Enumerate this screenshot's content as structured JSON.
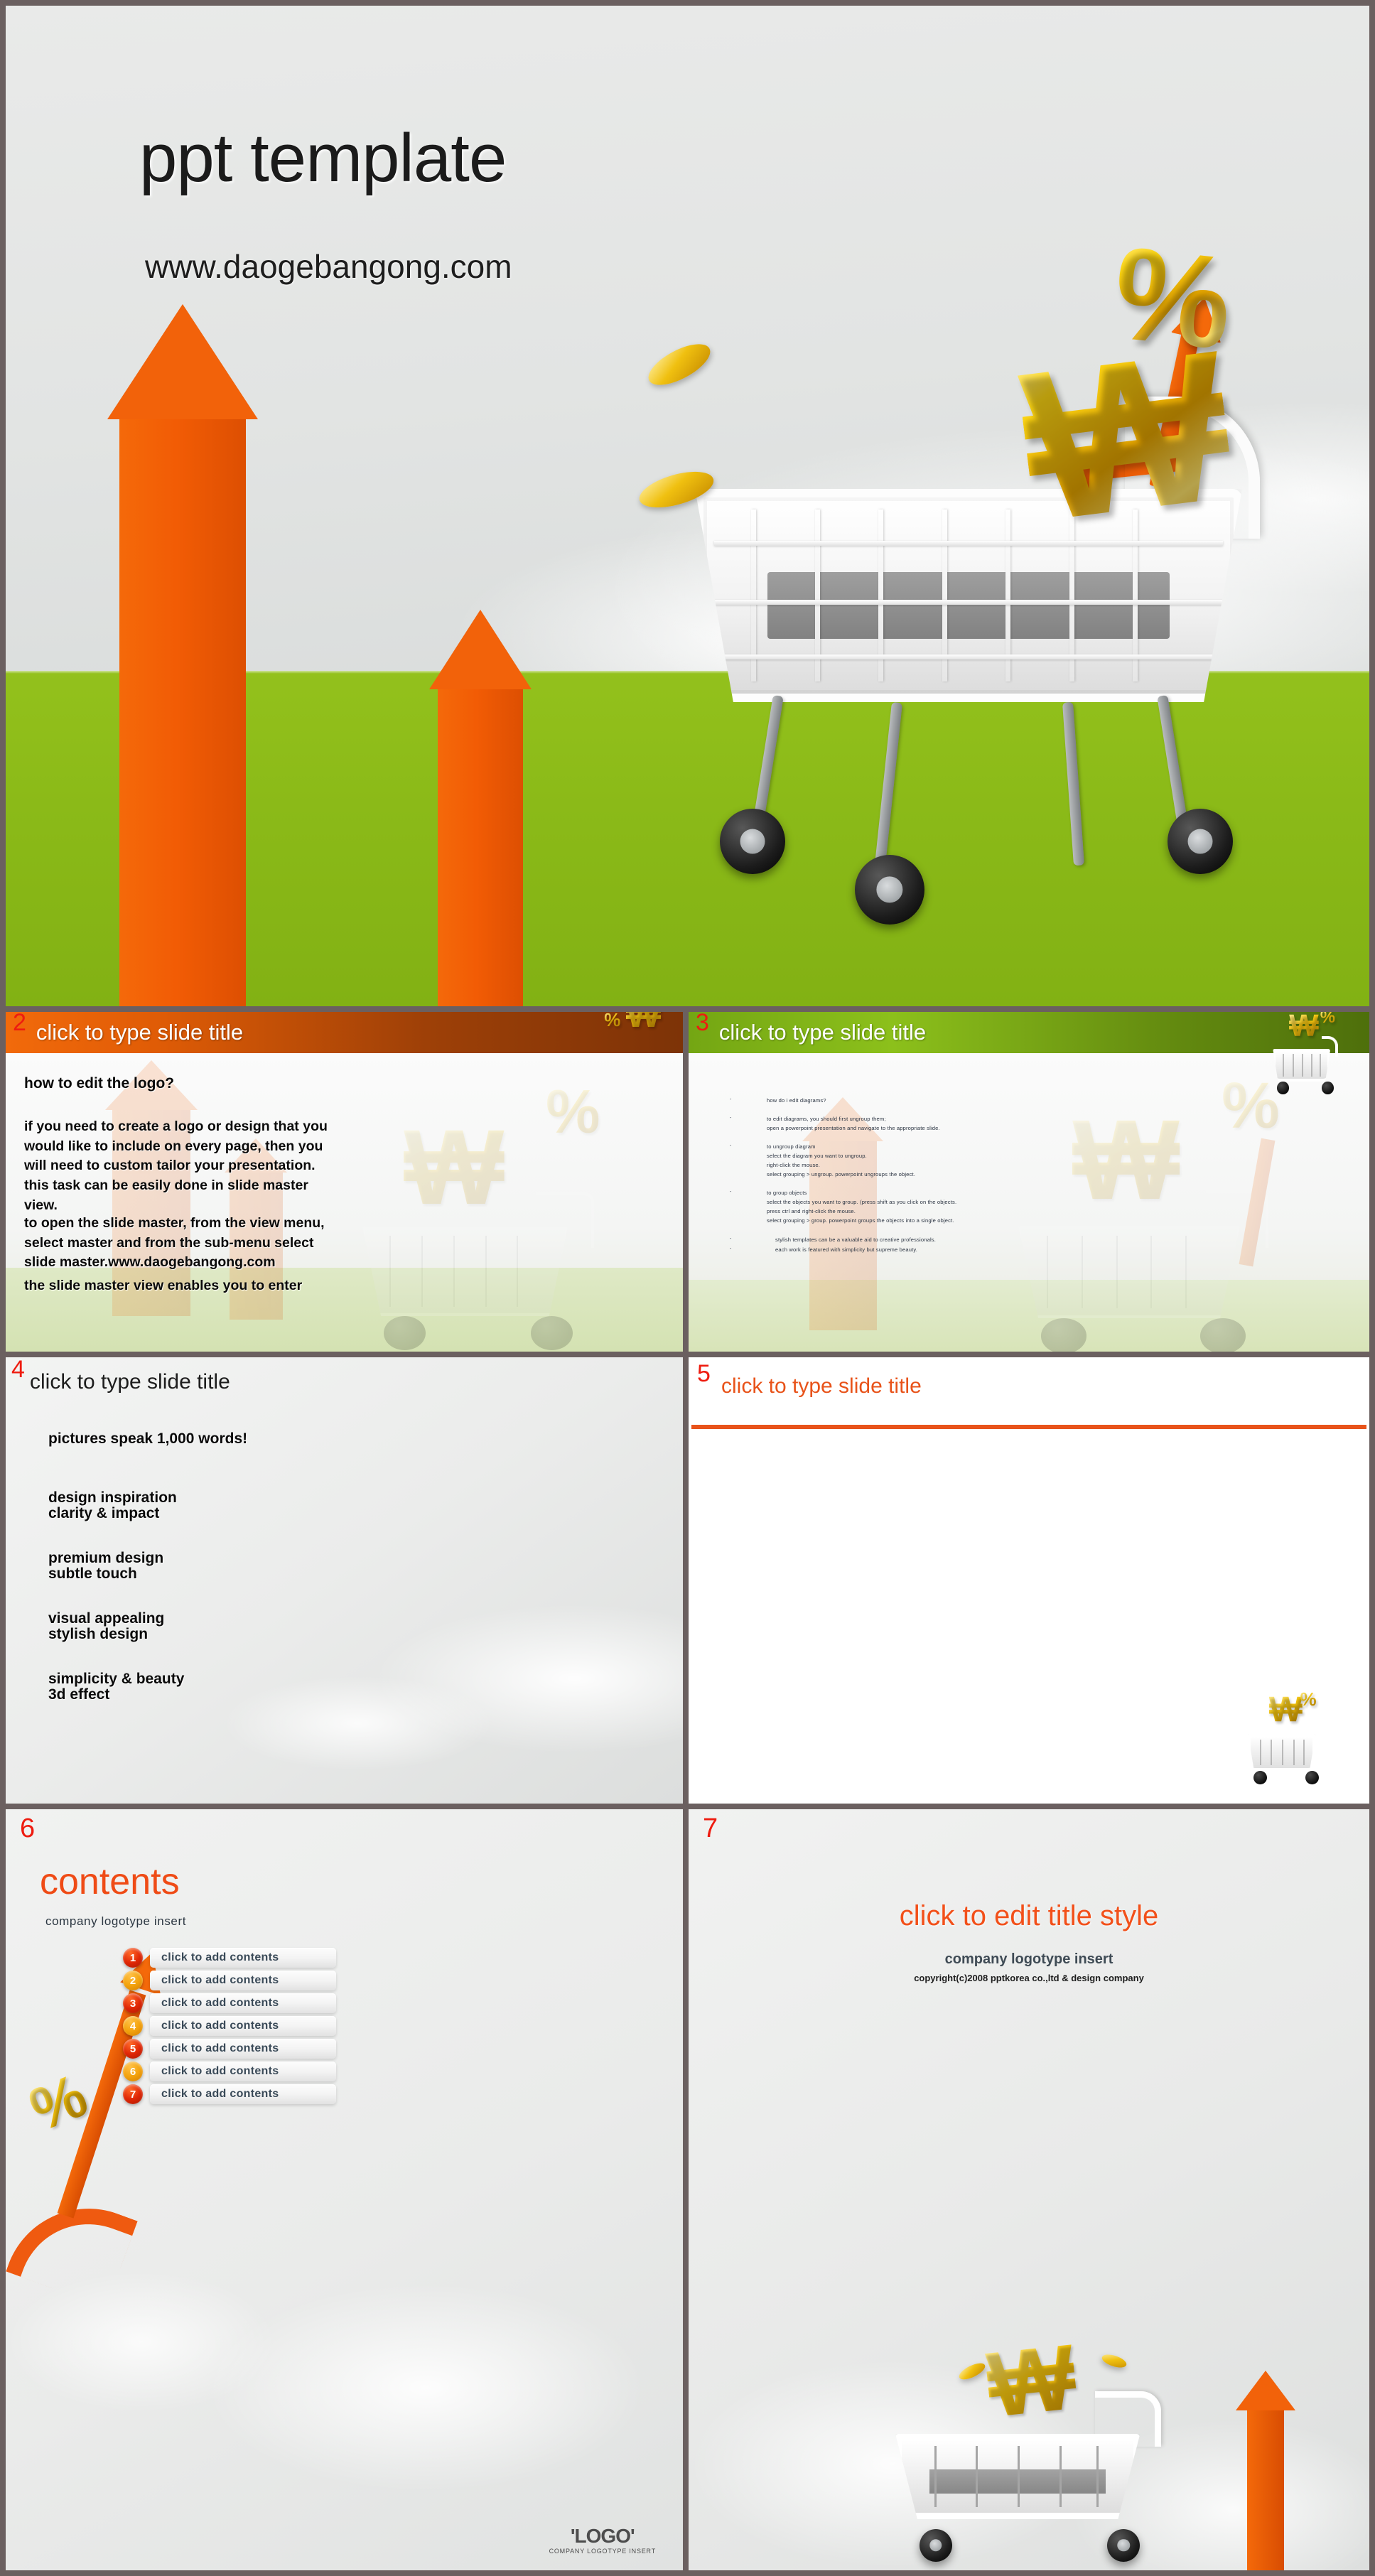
{
  "colors": {
    "orange": "#f2620a",
    "orange_text": "#e8531a",
    "red_number": "#ee1c10",
    "green_grass": "#8cbb19",
    "green_header": "#8cc01b",
    "gold": "#f0c010",
    "slate_text": "#3a4a58",
    "frame": "#6b6060"
  },
  "cover": {
    "title": "ppt template",
    "subtitle": "www.daogebangong.com",
    "graphics": {
      "won_symbol": "₩",
      "percent_symbol": "%",
      "cart": "shopping-cart",
      "arrows": "up-arrow"
    }
  },
  "slides": [
    {
      "number": "2",
      "title": "click to type slide title",
      "heading": "how to edit the logo?",
      "paragraphs": [
        "if you need to create a logo or design that you would like to include on every page, then you will need to custom tailor your presentation. this task can be easily done in slide master view.",
        "to open the slide master, from the view menu, select master and from the sub-menu select slide master.www.daogebangong.com",
        "the slide master view enables you to enter"
      ]
    },
    {
      "number": "3",
      "title": "click to type slide title",
      "bullets": [
        {
          "dash": "-",
          "lines": [
            "how do i edit diagrams?"
          ]
        },
        {
          "dash": "-",
          "lines": [
            "to edit diagrams,  you should first ungroup them;",
            "open a powerpoint  presentation and navigate to the appropriate  slide."
          ]
        },
        {
          "dash": "-",
          "lines": [
            "to ungroup  diagram",
            "select the diagram  you want to ungroup.",
            "right-click  the mouse.",
            "select grouping  > ungroup.  powerpoint  ungroups  the object."
          ]
        },
        {
          "dash": "-",
          "lines": [
            "to group objects",
            "select the objects  you want to group.  (press shift as you click  on the objects.",
            "press ctrl and right-click  the mouse.",
            "select grouping  > group.  powerpoint  groups  the objects into  a single  object."
          ]
        },
        {
          "dash": "-",
          "lines": [
            "stylish  templates can be a valuable  aid to creative professionals."
          ]
        },
        {
          "dash": "-",
          "lines": [
            "each work is featured with simplicity  but supreme  beauty."
          ]
        }
      ]
    },
    {
      "number": "4",
      "title": "click to type slide title",
      "lines": [
        "pictures speak 1,000 words!",
        "design inspiration",
        "clarity & impact",
        "premium design",
        "subtle touch",
        "visual appealing",
        "stylish design",
        "simplicity & beauty",
        "3d effect"
      ]
    },
    {
      "number": "5",
      "title": "click to type slide title"
    },
    {
      "number": "6",
      "heading": "contents",
      "subheading": "company logotype insert",
      "items": [
        {
          "num": "1",
          "label": "click to add contents",
          "tone": "red"
        },
        {
          "num": "2",
          "label": "click to add contents",
          "tone": "orange"
        },
        {
          "num": "3",
          "label": "click to add contents",
          "tone": "red"
        },
        {
          "num": "4",
          "label": "click to add contents",
          "tone": "orange"
        },
        {
          "num": "5",
          "label": "click to add contents",
          "tone": "red"
        },
        {
          "num": "6",
          "label": "click to add contents",
          "tone": "orange"
        },
        {
          "num": "7",
          "label": "click to add contents",
          "tone": "red"
        }
      ],
      "logo": {
        "main": "'LOGO'",
        "sub": "COMPANY LOGOTYPE  INSERT"
      }
    },
    {
      "number": "7",
      "title": "click to edit title style",
      "subtitle": "company logotype insert",
      "copyright": "copyright(c)2008 pptkorea co.,ltd & design company"
    }
  ]
}
